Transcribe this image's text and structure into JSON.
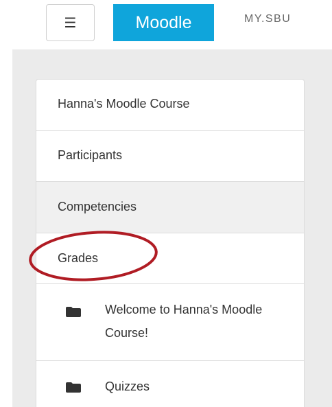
{
  "header": {
    "menu_icon": "hamburger-icon",
    "menu_glyph": "☰",
    "brand_label": "Moodle",
    "site_link": "MY.SBU"
  },
  "nav": {
    "items": [
      {
        "label": "Hanna's Moodle Course"
      },
      {
        "label": "Participants"
      },
      {
        "label": "Competencies",
        "active": true
      },
      {
        "label": "Grades",
        "highlighted": true
      }
    ],
    "sub_items": [
      {
        "icon": "folder-icon",
        "label": "Welcome to Hanna's Moodle Course!"
      },
      {
        "icon": "folder-icon",
        "label": "Quizzes"
      }
    ]
  },
  "colors": {
    "brand": "#0fa5db",
    "annotation_circle": "#b01c24",
    "panel_background": "#ebebeb",
    "active_item": "#f0f0f0"
  }
}
